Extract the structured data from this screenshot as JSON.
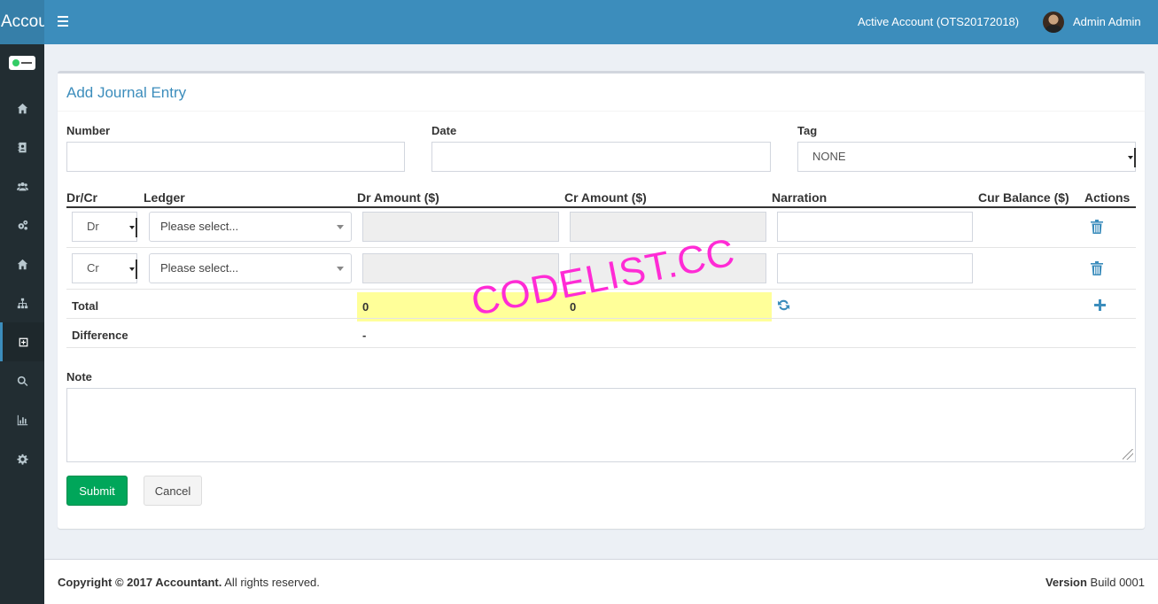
{
  "header": {
    "brand": "Accou",
    "active_account": "Active Account (OTS20172018)",
    "user_name": "Admin Admin"
  },
  "sidebar": {
    "items": [
      {
        "icon": "home-icon"
      },
      {
        "icon": "address-book-icon"
      },
      {
        "icon": "users-icon"
      },
      {
        "icon": "cogs-icon"
      },
      {
        "icon": "home-icon"
      },
      {
        "icon": "sitemap-icon"
      },
      {
        "icon": "plus-square-icon",
        "active": true
      },
      {
        "icon": "search-icon"
      },
      {
        "icon": "bar-chart-icon"
      },
      {
        "icon": "gear-icon"
      }
    ]
  },
  "form": {
    "title": "Add Journal Entry",
    "number_label": "Number",
    "number_value": "",
    "date_label": "Date",
    "date_value": "",
    "tag_label": "Tag",
    "tag_value": "NONE",
    "columns": [
      "Dr/Cr",
      "Ledger",
      "Dr Amount ($)",
      "Cr Amount ($)",
      "Narration",
      "Cur Balance ($)",
      "Actions"
    ],
    "rows": [
      {
        "drcr": "Dr",
        "ledger_placeholder": "Please select...",
        "dr_amount": "",
        "cr_amount": "",
        "narration": "",
        "cur_balance": ""
      },
      {
        "drcr": "Cr",
        "ledger_placeholder": "Please select...",
        "dr_amount": "",
        "cr_amount": "",
        "narration": "",
        "cur_balance": ""
      }
    ],
    "total_label": "Total",
    "total_dr": "0",
    "total_cr": "0",
    "difference_label": "Difference",
    "difference_value": "-",
    "note_label": "Note",
    "note_value": "",
    "submit_label": "Submit",
    "cancel_label": "Cancel",
    "highlight_color": "#ffff99"
  },
  "watermark": "CODELIST.CC",
  "footer": {
    "copyright_bold": "Copyright © 2017 Accountant.",
    "copyright_rest": " All rights reserved.",
    "version_label": "Version",
    "version_value": " Build 0001"
  },
  "colors": {
    "header": "#3c8dbc",
    "sidebar": "#222d32",
    "primary": "#3c8dbc",
    "success": "#00a65a"
  }
}
